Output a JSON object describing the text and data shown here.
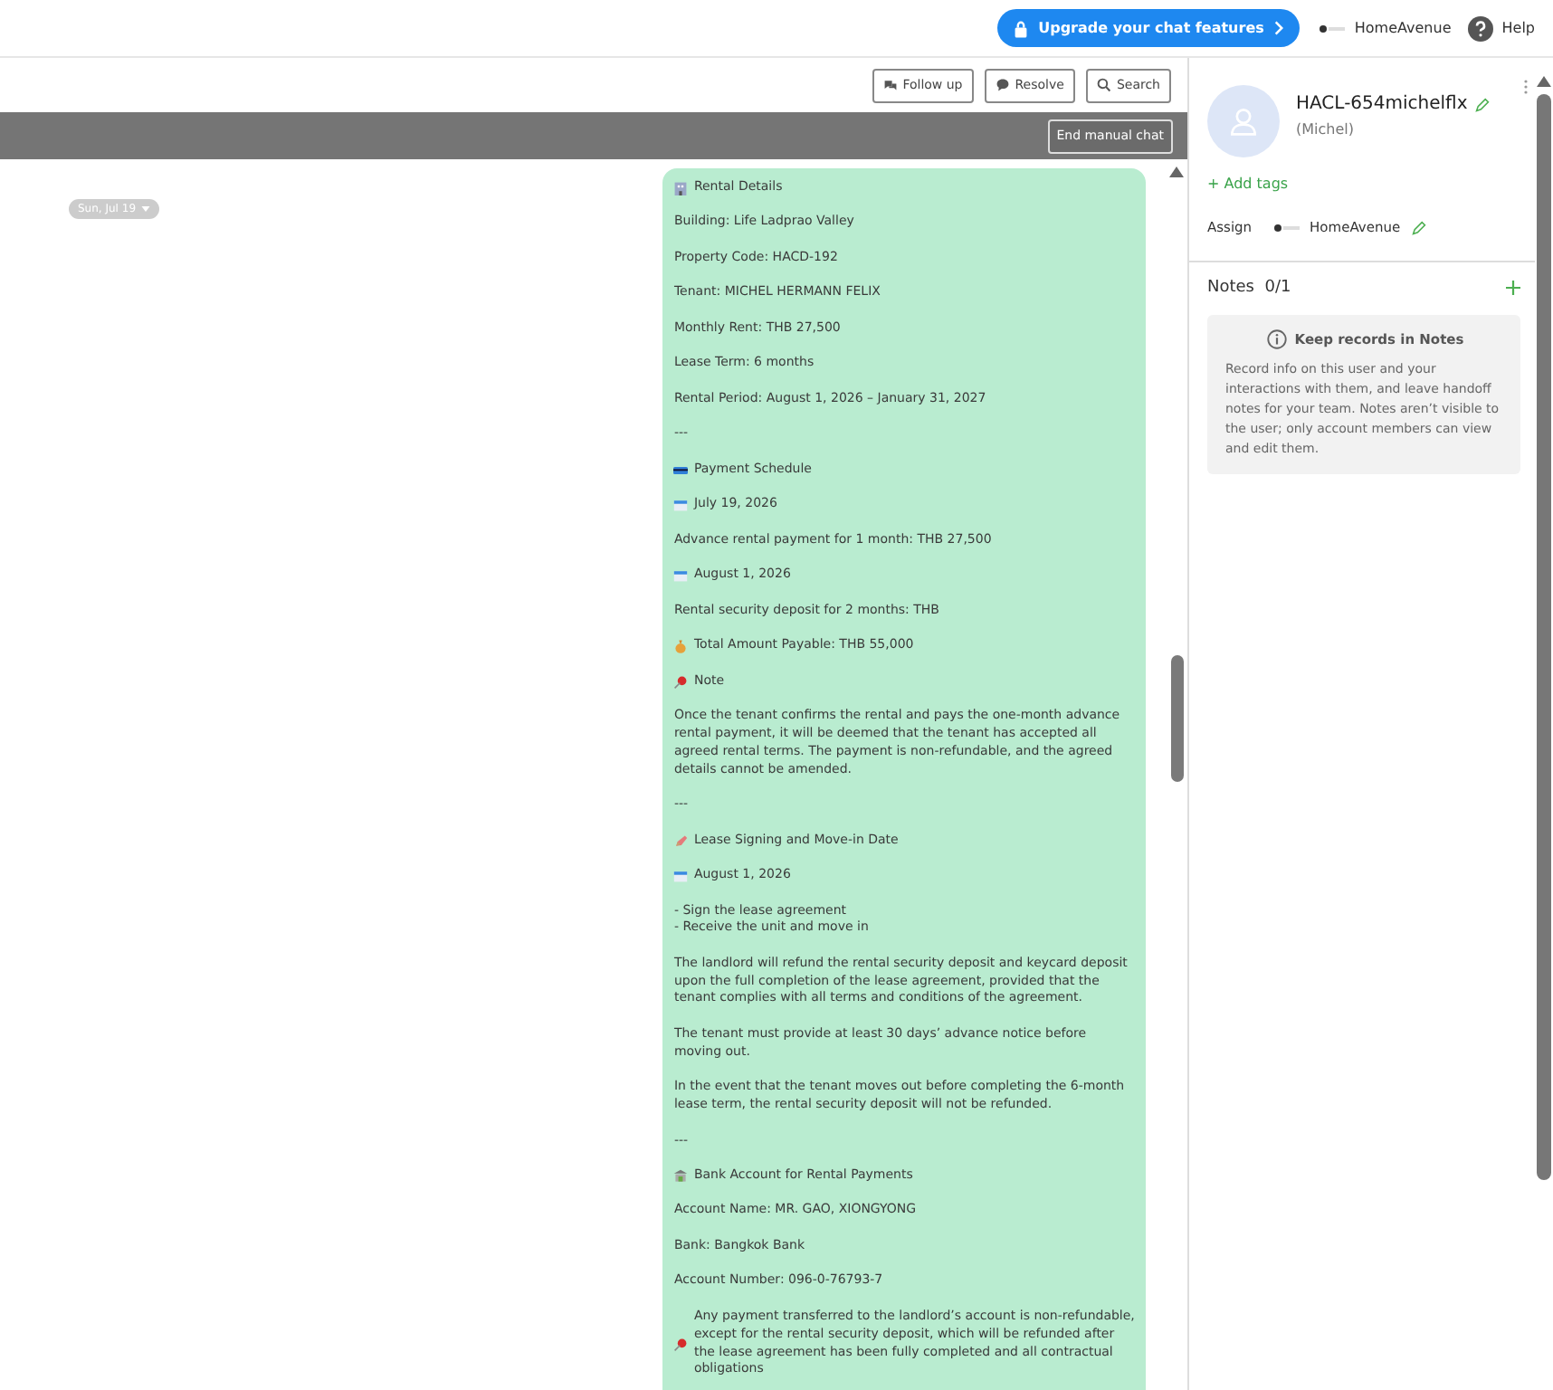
{
  "header": {
    "upgrade_button": "Upgrade your chat features",
    "account": "HomeAvenue",
    "help": "Help"
  },
  "toolbar": {
    "buttons": [
      {
        "kind": "followup",
        "label": "Follow up"
      },
      {
        "kind": "resolve",
        "label": "Resolve"
      },
      {
        "kind": "search",
        "label": "Search"
      }
    ],
    "end_button": "End manual chat"
  },
  "date_pill": "Sun, Jul 19",
  "message": [
    {
      "kind": "building",
      "text": "Rental Details"
    },
    {
      "kind": "text",
      "text": "Building: Life Ladprao Valley"
    },
    {
      "kind": "text",
      "text": "Property Code: HACD-192"
    },
    {
      "kind": "text",
      "text": "Tenant: MICHEL HERMANN FELIX"
    },
    {
      "kind": "text",
      "text": "Monthly Rent: THB 27,500"
    },
    {
      "kind": "text",
      "text": "Lease Term: 6 months"
    },
    {
      "kind": "text",
      "text": "Rental Period: August 1, 2026 – January 31, 2027"
    },
    {
      "kind": "text",
      "text": "---"
    },
    {
      "kind": "card",
      "text": "Payment Schedule"
    },
    {
      "kind": "calendar",
      "text": "July 19, 2026"
    },
    {
      "kind": "text",
      "text": "Advance rental payment for 1 month: THB 27,500"
    },
    {
      "kind": "calendar",
      "text": "August 1, 2026"
    },
    {
      "kind": "text",
      "text": "Rental security deposit for 2 months: THB"
    },
    {
      "kind": "money",
      "text": "Total Amount Payable: THB 55,000"
    },
    {
      "kind": "pin",
      "text": "Note"
    },
    {
      "kind": "text",
      "text": "Once the tenant confirms the rental and pays the one-month advance rental payment, it will be deemed that the tenant has accepted all agreed rental terms. The payment is non-refundable, and the agreed details cannot be amended."
    },
    {
      "kind": "text",
      "text": "---"
    },
    {
      "kind": "pen",
      "text": "Lease Signing and Move-in Date"
    },
    {
      "kind": "calendar",
      "text": "August 1, 2026"
    },
    {
      "kind": "lines",
      "lines": [
        "- Sign the lease agreement",
        "- Receive the unit and move in"
      ]
    },
    {
      "kind": "text",
      "text": "The landlord will refund the rental security deposit and keycard deposit upon the full completion of the lease agreement, provided that the tenant complies with all terms and conditions of the agreement."
    },
    {
      "kind": "text",
      "text": "The tenant must provide at least 30 days’ advance notice before moving out."
    },
    {
      "kind": "text",
      "text": "In the event that the tenant moves out before completing the 6-month lease term, the rental security deposit will not be refunded."
    },
    {
      "kind": "text",
      "text": "---"
    },
    {
      "kind": "bank",
      "text": "Bank Account for Rental Payments"
    },
    {
      "kind": "text",
      "text": "Account Name: MR. GAO, XIONGYONG"
    },
    {
      "kind": "text",
      "text": "Bank: Bangkok Bank"
    },
    {
      "kind": "text",
      "text": "Account Number: 096-0-76793-7"
    },
    {
      "kind": "pin",
      "text": "Any payment transferred to the landlord’s account is non-refundable, except for the rental security deposit, which will be refunded after the lease agreement has been fully completed and all contractual obligations"
    }
  ],
  "contact": {
    "name": "HACL-654michelflx",
    "nickname": "(Michel)",
    "add_tags": "+ Add tags",
    "assign_label": "Assign",
    "assignee": "HomeAvenue"
  },
  "notes": {
    "title": "Notes",
    "count": "0/1",
    "card_title": "Keep records in Notes",
    "card_text": "Record info on this user and your interactions with them, and leave handoff notes for your team. Notes aren’t visible to the user; only account members can view and edit them."
  }
}
